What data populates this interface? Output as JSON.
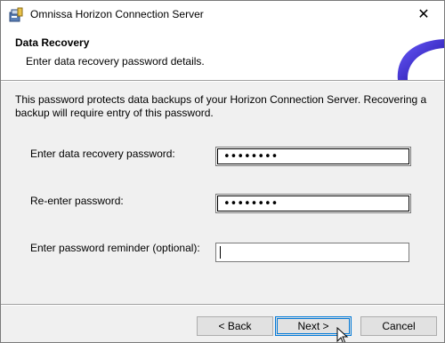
{
  "window": {
    "title": "Omnissa Horizon Connection Server",
    "icon": "installer-icon",
    "close_glyph": "✕"
  },
  "header": {
    "title": "Data Recovery",
    "subtitle": "Enter data recovery password details.",
    "logo": "omnissa-arc-logo"
  },
  "description": "This password protects data backups of your Horizon Connection Server. Recovering a backup will require entry of this password.",
  "form": {
    "password_label": "Enter data recovery password:",
    "password_value": "••••••••",
    "reenter_label": "Re-enter password:",
    "reenter_value": "••••••••",
    "reminder_label": "Enter password reminder (optional):",
    "reminder_value": ""
  },
  "buttons": {
    "back": "< Back",
    "next": "Next >",
    "cancel": "Cancel"
  },
  "colors": {
    "accent": "#0078d7",
    "logo_purple": "#3b1fc2"
  }
}
